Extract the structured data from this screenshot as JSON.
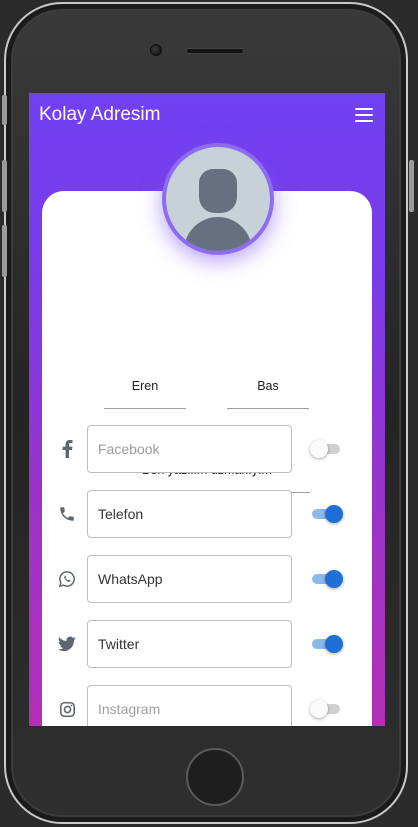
{
  "app": {
    "title": "Kolay Adresim"
  },
  "profile": {
    "first_name": "Eren",
    "last_name": "Bas",
    "bio": "Ben yazılım uzmanıyım"
  },
  "social": [
    {
      "icon": "facebook-icon",
      "label": "Facebook",
      "enabled": false,
      "placeholder": true
    },
    {
      "icon": "phone-icon",
      "label": "Telefon",
      "enabled": true,
      "placeholder": false
    },
    {
      "icon": "whatsapp-icon",
      "label": "WhatsApp",
      "enabled": true,
      "placeholder": false
    },
    {
      "icon": "twitter-icon",
      "label": "Twitter",
      "enabled": true,
      "placeholder": false
    },
    {
      "icon": "instagram-icon",
      "label": "Instagram",
      "enabled": false,
      "placeholder": true
    }
  ],
  "colors": {
    "gradient_top": "#7141f2",
    "gradient_bottom": "#b22fb6",
    "toggle_on": "#1e6fd6",
    "icon": "#5f6670"
  }
}
